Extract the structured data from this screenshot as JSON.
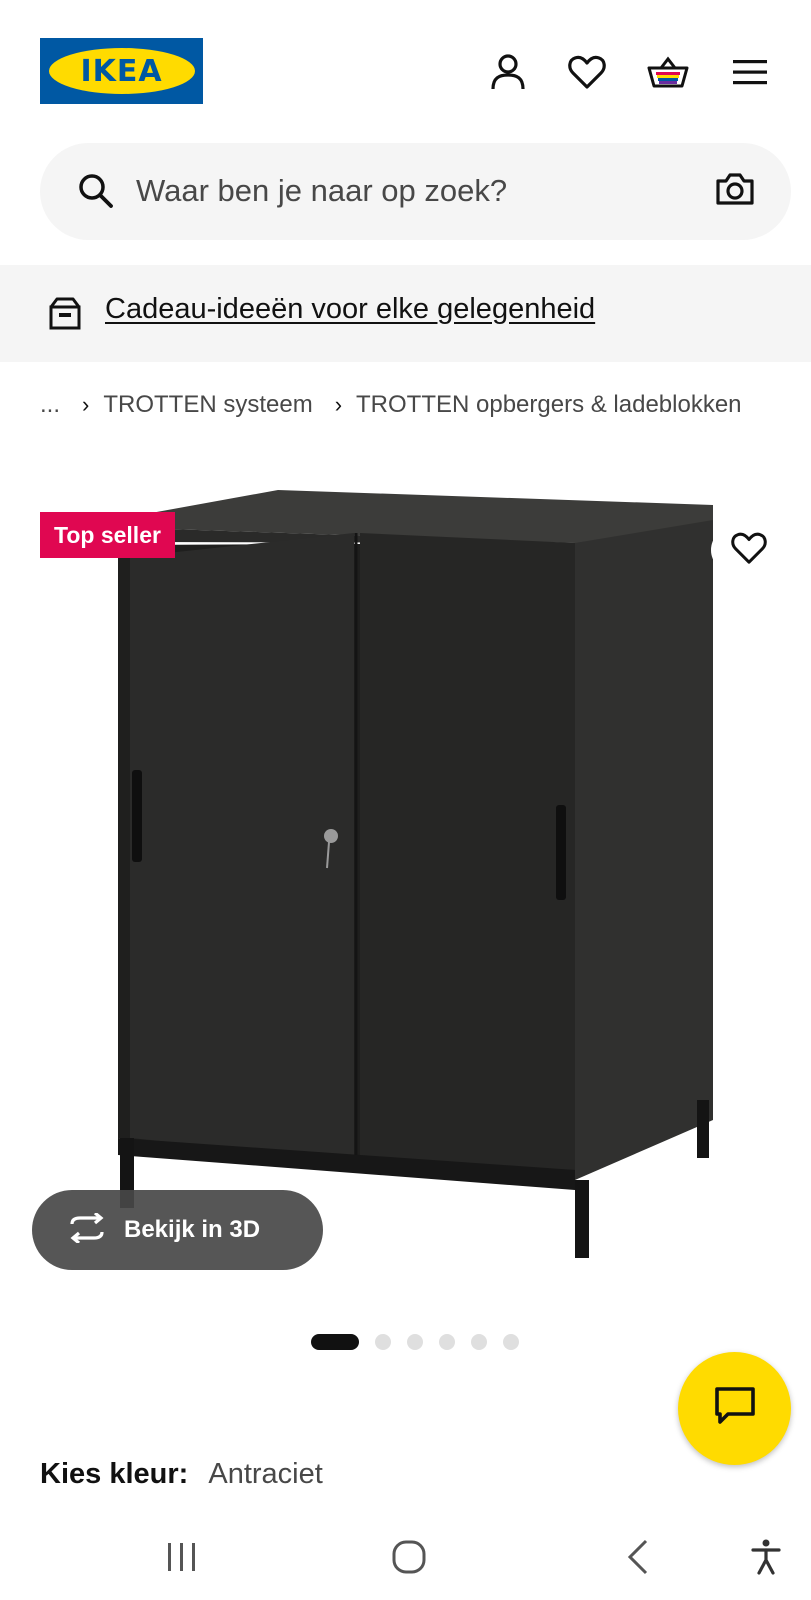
{
  "header": {
    "logo_text": "IKEA",
    "icons": [
      "user-icon",
      "heart-icon",
      "basket-icon",
      "menu-icon"
    ]
  },
  "search": {
    "placeholder": "Waar ben je naar op zoek?"
  },
  "banner": {
    "link_text": "Cadeau-ideeën voor elke gelegenheid"
  },
  "breadcrumb": {
    "ellipsis": "...",
    "items": [
      "TROTTEN systeem",
      "TROTTEN opbergers & ladeblokken"
    ]
  },
  "product": {
    "badge": "Top seller",
    "view3d_label": "Bekijk in 3D",
    "carousel": {
      "total": 6,
      "active": 1
    },
    "color_label": "Kies kleur:",
    "color_value": "Antraciet"
  },
  "colors": {
    "brand_blue": "#0058a3",
    "brand_yellow": "#ffdb00",
    "badge_red": "#e00751"
  }
}
